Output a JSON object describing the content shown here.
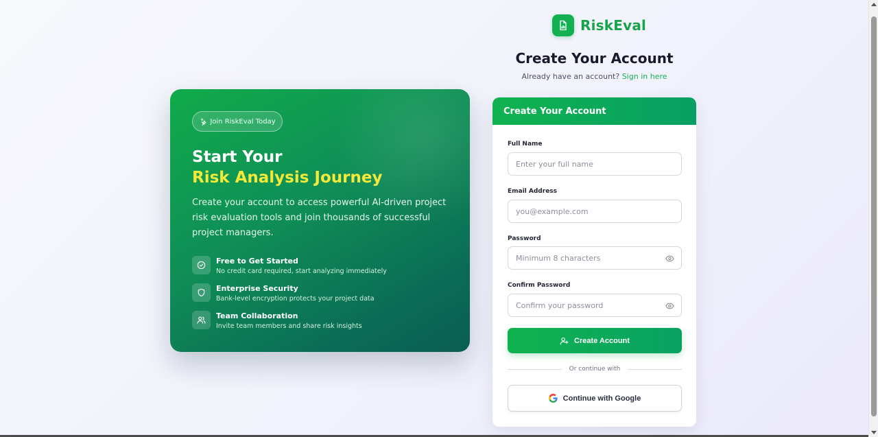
{
  "brand": {
    "name": "RiskEval",
    "color": "#16a34a"
  },
  "header": {
    "title": "Create Your Account",
    "signin_prompt": "Already have an account?",
    "signin_link": "Sign in here"
  },
  "hero": {
    "badge": "Join RiskEval Today",
    "title_line1": "Start Your",
    "title_line2": "Risk Analysis Journey",
    "description": "Create your account to access powerful AI-driven project risk evaluation tools and join thousands of successful project managers.",
    "features": [
      {
        "icon": "check-circle-icon",
        "title": "Free to Get Started",
        "desc": "No credit card required, start analyzing immediately"
      },
      {
        "icon": "shield-icon",
        "title": "Enterprise Security",
        "desc": "Bank-level encryption protects your project data"
      },
      {
        "icon": "users-icon",
        "title": "Team Collaboration",
        "desc": "Invite team members and share risk insights"
      }
    ]
  },
  "form": {
    "header": "Create Your Account",
    "fields": {
      "full_name": {
        "label": "Full Name",
        "placeholder": "Enter your full name"
      },
      "email": {
        "label": "Email Address",
        "placeholder": "you@example.com"
      },
      "password": {
        "label": "Password",
        "placeholder": "Minimum 8 characters"
      },
      "confirm_password": {
        "label": "Confirm Password",
        "placeholder": "Confirm your password"
      }
    },
    "submit_label": "Create Account",
    "divider_text": "Or continue with",
    "google_label": "Continue with Google"
  },
  "colors": {
    "accent_green": "#10b24f",
    "highlight_yellow": "#f4e93a",
    "hero_dark": "#0a5e52"
  }
}
